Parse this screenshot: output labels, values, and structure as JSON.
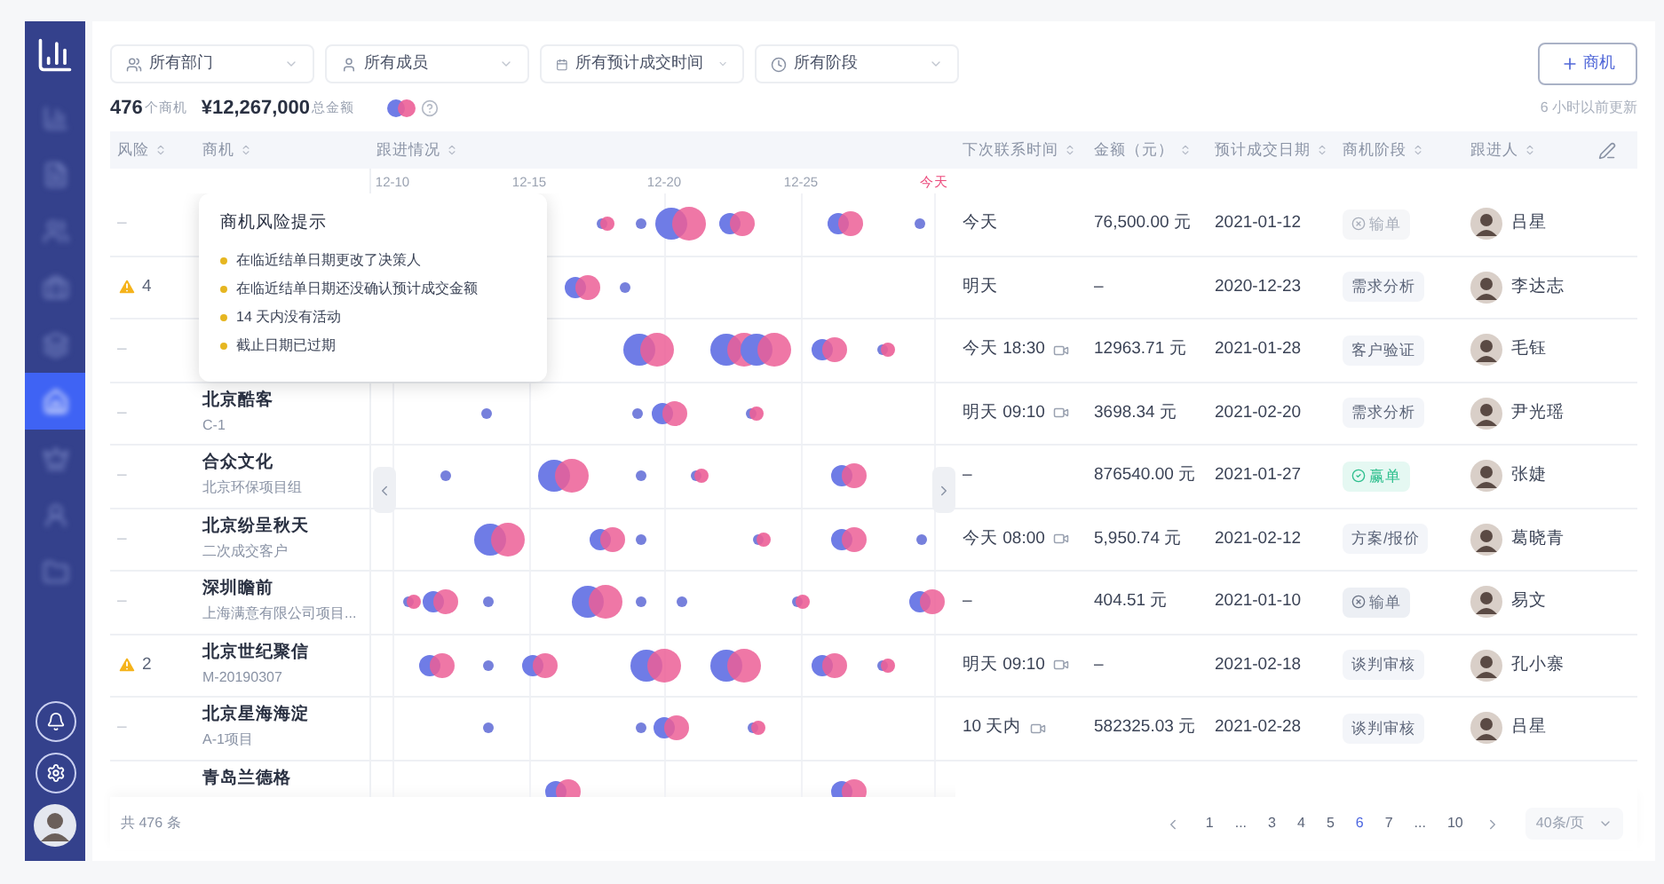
{
  "sidebar": {
    "items": [
      {
        "selected": false
      },
      {
        "selected": false
      },
      {
        "selected": false
      },
      {
        "selected": false
      },
      {
        "selected": false
      },
      {
        "selected": true
      },
      {
        "selected": false
      },
      {
        "selected": false
      },
      {
        "selected": false
      }
    ]
  },
  "filters": [
    {
      "kind": "department",
      "label": "所有部门"
    },
    {
      "kind": "member",
      "label": "所有成员"
    },
    {
      "kind": "date",
      "label": "所有预计成交时间"
    },
    {
      "kind": "stage",
      "label": "所有阶段"
    }
  ],
  "add_button": {
    "label": "商机"
  },
  "stats": {
    "count": "476",
    "count_unit": "个商机",
    "amount": "¥12,267,000",
    "amount_unit": "总金额"
  },
  "updated": "6 小时以前更新",
  "columns": [
    "风险",
    "商机",
    "跟进情况",
    "下次联系时间",
    "金额（元）",
    "预计成交日期",
    "商机阶段",
    "跟进人"
  ],
  "timeline_ticks": [
    {
      "kind": "date",
      "label": "12-10"
    },
    {
      "kind": "date",
      "label": "12-15"
    },
    {
      "kind": "date",
      "label": "12-20"
    },
    {
      "kind": "date",
      "label": "12-25"
    },
    {
      "kind": "today",
      "label": "今天"
    }
  ],
  "rows": [
    {
      "risk": {
        "kind": "none",
        "text": "–"
      },
      "next_contact": "今天",
      "video": false,
      "amount": "76,500.00 元",
      "close_date": "2021-01-12",
      "stage": {
        "kind": "faded",
        "label": "输单"
      },
      "owner": "吕星"
    },
    {
      "risk": {
        "kind": "warning",
        "text": "4"
      },
      "next_contact": "明天",
      "video": false,
      "amount": "–",
      "close_date": "2020-12-23",
      "stage": {
        "kind": "plain",
        "label": "需求分析"
      },
      "owner": "李达志"
    },
    {
      "risk": {
        "kind": "none",
        "text": "–"
      },
      "next_contact": "今天 18:30",
      "video": true,
      "amount": "12963.71 元",
      "close_date": "2021-01-28",
      "stage": {
        "kind": "plain",
        "label": "客户验证"
      },
      "owner": "毛钰"
    },
    {
      "risk": {
        "kind": "none",
        "text": "–"
      },
      "name": "北京酷客",
      "subtitle": "C-1",
      "next_contact": "明天 09:10",
      "video": true,
      "amount": "3698.34 元",
      "close_date": "2021-02-20",
      "stage": {
        "kind": "plain",
        "label": "需求分析"
      },
      "owner": "尹光瑶"
    },
    {
      "risk": {
        "kind": "none",
        "text": "–"
      },
      "name": "合众文化",
      "subtitle": "北京环保项目组",
      "next_contact": "–",
      "video": false,
      "amount": "876540.00 元",
      "close_date": "2021-01-27",
      "stage": {
        "kind": "won",
        "label": "赢单"
      },
      "owner": "张婕"
    },
    {
      "risk": {
        "kind": "none",
        "text": "–"
      },
      "name": "北京纷呈秋天",
      "subtitle": "二次成交客户",
      "next_contact": "今天 08:00",
      "video": true,
      "amount": "5,950.74 元",
      "close_date": "2021-02-12",
      "stage": {
        "kind": "plain",
        "label": "方案/报价"
      },
      "owner": "葛晓青"
    },
    {
      "risk": {
        "kind": "none",
        "text": "–"
      },
      "name": "深圳瞻前",
      "subtitle": "上海满意有限公司项目...",
      "next_contact": "–",
      "video": false,
      "amount": "404.51 元",
      "close_date": "2021-01-10",
      "stage": {
        "kind": "lost",
        "label": "输单"
      },
      "owner": "易文"
    },
    {
      "risk": {
        "kind": "warning",
        "text": "2"
      },
      "name": "北京世纪聚信",
      "subtitle": "M-20190307",
      "next_contact": "明天 09:10",
      "video": true,
      "amount": "–",
      "close_date": "2021-02-18",
      "stage": {
        "kind": "plain",
        "label": "谈判审核"
      },
      "owner": "孔小寨"
    },
    {
      "risk": {
        "kind": "none",
        "text": "–"
      },
      "name": "北京星海海淀",
      "subtitle": "A-1项目",
      "next_contact": "10 天内",
      "video": true,
      "amount": "582325.03 元",
      "close_date": "2021-02-28",
      "stage": {
        "kind": "plain",
        "label": "谈判审核"
      },
      "owner": "吕星"
    },
    {
      "name": "青岛兰德格"
    }
  ],
  "tooltip": {
    "title": "商机风险提示",
    "items": [
      "在临近结单日期更改了决策人",
      "在临近结单日期还没确认预计成交金额",
      "14 天内没有活动",
      "截止日期已过期"
    ]
  },
  "footer": {
    "total": "共 476 条",
    "pages": [
      {
        "label": "1",
        "selected": false
      },
      {
        "label": "...",
        "selected": false
      },
      {
        "label": "3",
        "selected": false
      },
      {
        "label": "4",
        "selected": false
      },
      {
        "label": "5",
        "selected": false
      },
      {
        "label": "6",
        "selected": true
      },
      {
        "label": "7",
        "selected": false
      },
      {
        "label": "...",
        "selected": false
      },
      {
        "label": "10",
        "selected": false
      }
    ],
    "page_size": "40条/页"
  }
}
